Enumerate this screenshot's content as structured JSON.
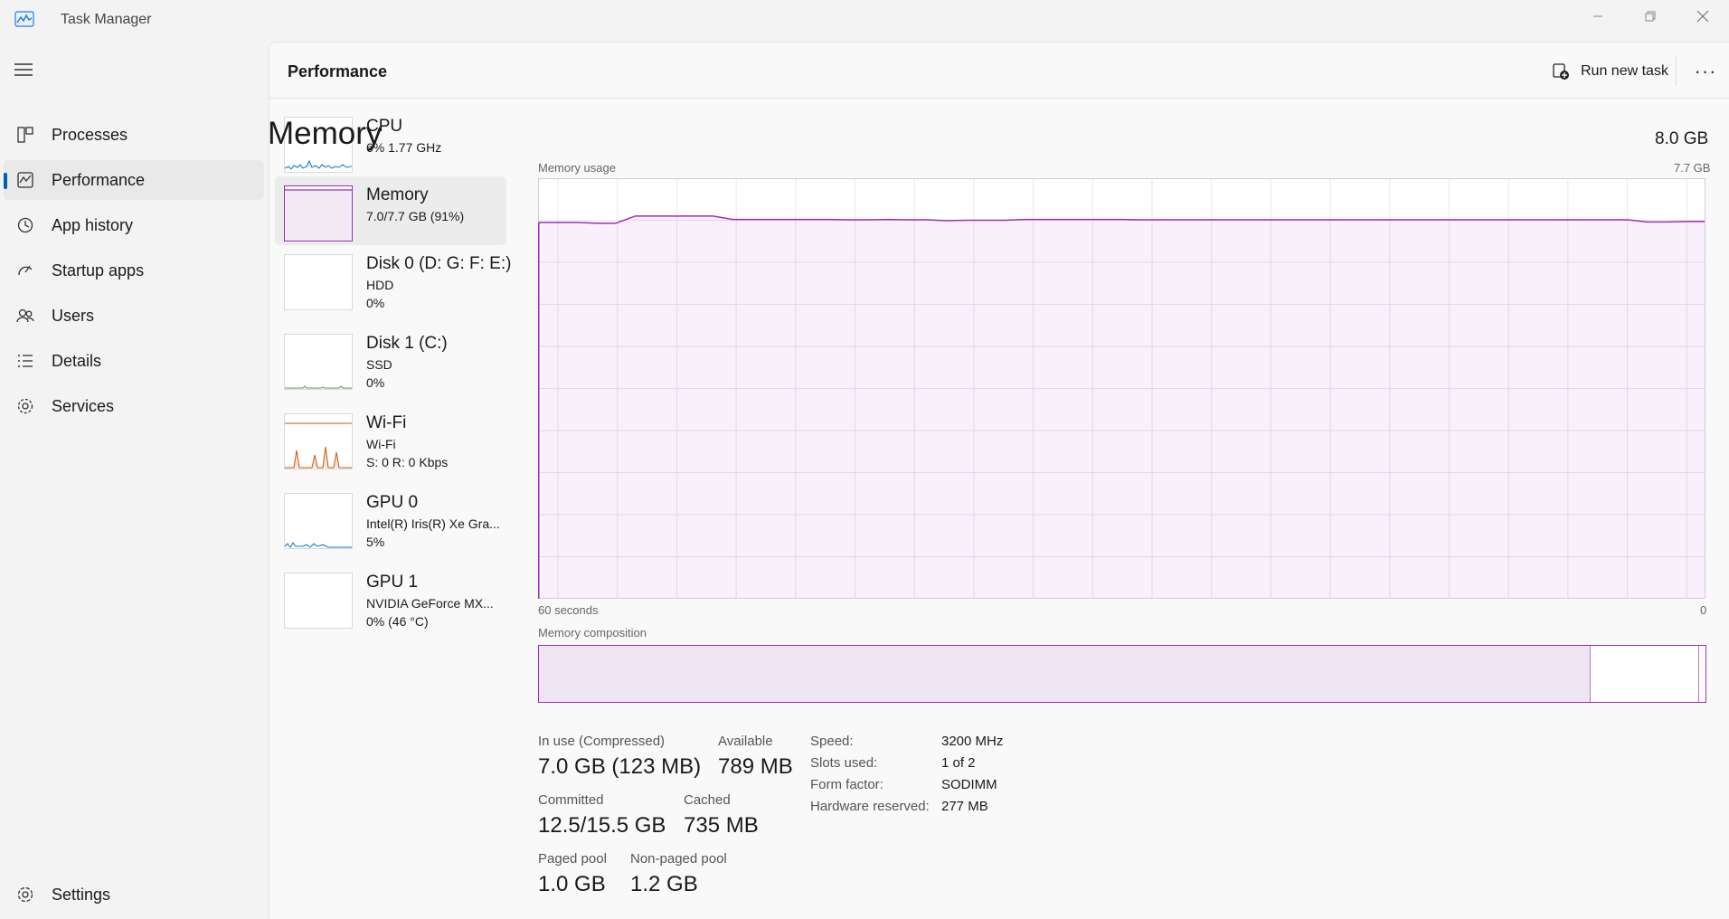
{
  "window": {
    "title": "Task Manager"
  },
  "nav": {
    "items": [
      {
        "label": "Processes",
        "icon": "processes-icon"
      },
      {
        "label": "Performance",
        "icon": "performance-icon",
        "active": true
      },
      {
        "label": "App history",
        "icon": "app-history-icon"
      },
      {
        "label": "Startup apps",
        "icon": "startup-apps-icon"
      },
      {
        "label": "Users",
        "icon": "users-icon"
      },
      {
        "label": "Details",
        "icon": "details-icon"
      },
      {
        "label": "Services",
        "icon": "services-icon"
      }
    ],
    "settings_label": "Settings"
  },
  "header": {
    "title": "Performance",
    "run_new_task": "Run new task",
    "more": "···"
  },
  "devices": [
    {
      "name": "CPU",
      "line1": "6%  1.77 GHz",
      "line2": ""
    },
    {
      "name": "Memory",
      "line1": "7.0/7.7 GB (91%)",
      "line2": "",
      "active": true
    },
    {
      "name": "Disk 0 (D: G: F: E:)",
      "line1": "HDD",
      "line2": "0%"
    },
    {
      "name": "Disk 1 (C:)",
      "line1": "SSD",
      "line2": "0%"
    },
    {
      "name": "Wi-Fi",
      "line1": "Wi-Fi",
      "line2": "S: 0  R: 0 Kbps"
    },
    {
      "name": "GPU 0",
      "line1": "Intel(R) Iris(R) Xe Gra...",
      "line2": "5%"
    },
    {
      "name": "GPU 1",
      "line1": "NVIDIA GeForce MX...",
      "line2": "0%  (46 °C)"
    }
  ],
  "memory": {
    "title": "Memory",
    "total": "8.0 GB",
    "usage_label": "Memory usage",
    "usage_max": "7.7 GB",
    "time_left": "60 seconds",
    "time_right": "0",
    "composition_label": "Memory composition",
    "composition": {
      "in_use_fraction": 0.902,
      "standby_fraction": 0.093
    },
    "usage_history_fraction": [
      0.895,
      0.895,
      0.895,
      0.893,
      0.893,
      0.91,
      0.91,
      0.91,
      0.91,
      0.91,
      0.902,
      0.902,
      0.902,
      0.902,
      0.902,
      0.902,
      0.901,
      0.901,
      0.902,
      0.901,
      0.901,
      0.899,
      0.9,
      0.9,
      0.9,
      0.902,
      0.902,
      0.902,
      0.902,
      0.902,
      0.902,
      0.901,
      0.901,
      0.901,
      0.901,
      0.901,
      0.901,
      0.901,
      0.901,
      0.901,
      0.901,
      0.901,
      0.901,
      0.901,
      0.901,
      0.901,
      0.901,
      0.901,
      0.901,
      0.901,
      0.901,
      0.901,
      0.901,
      0.901,
      0.901,
      0.901,
      0.901,
      0.896,
      0.896,
      0.897,
      0.897
    ],
    "stats": {
      "in_use_label": "In use (Compressed)",
      "in_use_value": "7.0 GB (123 MB)",
      "available_label": "Available",
      "available_value": "789 MB",
      "committed_label": "Committed",
      "committed_value": "12.5/15.5 GB",
      "cached_label": "Cached",
      "cached_value": "735 MB",
      "paged_label": "Paged pool",
      "paged_value": "1.0 GB",
      "nonpaged_label": "Non-paged pool",
      "nonpaged_value": "1.2 GB"
    },
    "specs": [
      {
        "key": "Speed:",
        "value": "3200 MHz"
      },
      {
        "key": "Slots used:",
        "value": "1 of 2"
      },
      {
        "key": "Form factor:",
        "value": "SODIMM"
      },
      {
        "key": "Hardware reserved:",
        "value": "277 MB"
      }
    ]
  },
  "colors": {
    "memory": "#9b2fb5",
    "cpu": "#1a78c2",
    "wifi": "#c55a11",
    "disk": "#4ca64c",
    "accent": "#005fb8"
  }
}
